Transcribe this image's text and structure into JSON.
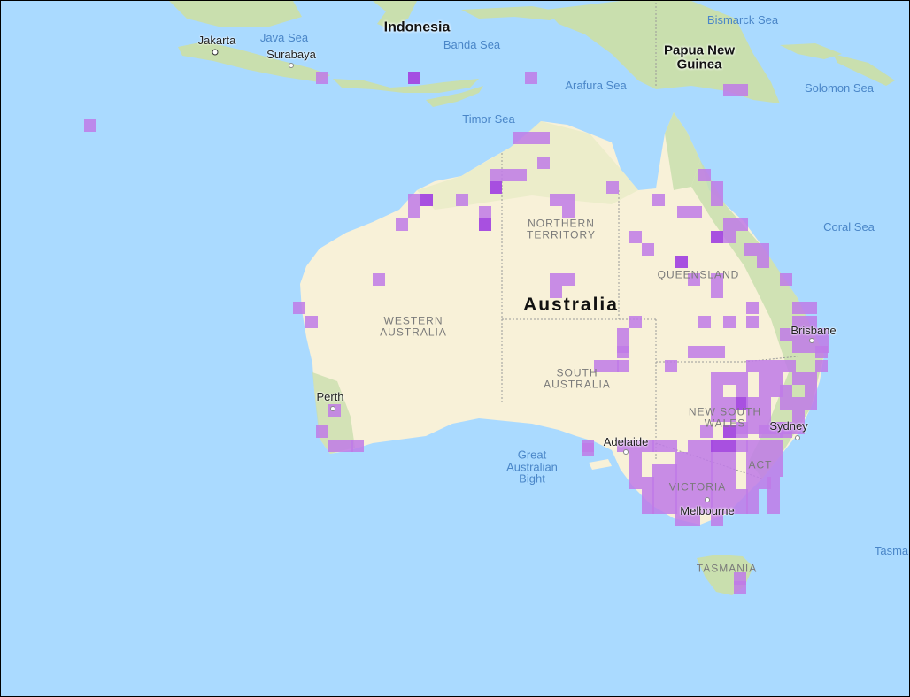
{
  "map": {
    "colors": {
      "water": "#aadaff",
      "land": "#f8f1d8",
      "vegetation": "#c9dfae",
      "cell_light": "#c07ae8",
      "cell_dark": "#a347e0"
    },
    "labels": {
      "indonesia": "Indonesia",
      "papua_new_guinea": "Papua New Guinea",
      "australia": "Australia",
      "jakarta": "Jakarta",
      "surabaya": "Surabaya",
      "java_sea": "Java Sea",
      "banda_sea": "Banda Sea",
      "bismarck_sea": "Bismarck Sea",
      "arafura_sea": "Arafura Sea",
      "solomon_sea": "Solomon Sea",
      "timor_sea": "Timor Sea",
      "coral_sea": "Coral Sea",
      "great_australian_bight": "Great Australian Bight",
      "tasman": "Tasma",
      "northern_territory": "NORTHERN TERRITORY",
      "western_australia": "WESTERN AUSTRALIA",
      "queensland": "QUEENSLAND",
      "south_australia": "SOUTH AUSTRALIA",
      "new_south_wales": "NEW SOUTH WALES",
      "victoria": "VICTORIA",
      "tasmania": "TASMANIA",
      "act": "ACT",
      "perth": "Perth",
      "adelaide": "Adelaide",
      "melbourne": "Melbourne",
      "sydney": "Sydney",
      "brisbane": "Brisbane"
    },
    "occurrence_cells": [
      [
        94,
        134,
        0
      ],
      [
        356,
        80,
        0
      ],
      [
        460,
        80,
        1
      ],
      [
        592,
        80,
        0
      ],
      [
        816,
        94,
        0
      ],
      [
        830,
        94,
        0
      ],
      [
        578,
        148,
        0
      ],
      [
        592,
        148,
        0
      ],
      [
        606,
        148,
        0
      ],
      [
        606,
        176,
        0
      ],
      [
        552,
        190,
        0
      ],
      [
        566,
        190,
        0
      ],
      [
        580,
        190,
        0
      ],
      [
        788,
        190,
        0
      ],
      [
        552,
        204,
        1
      ],
      [
        684,
        204,
        0
      ],
      [
        802,
        204,
        0
      ],
      [
        460,
        218,
        0
      ],
      [
        474,
        218,
        1
      ],
      [
        514,
        218,
        0
      ],
      [
        620,
        218,
        0
      ],
      [
        634,
        218,
        0
      ],
      [
        736,
        218,
        0
      ],
      [
        802,
        218,
        0
      ],
      [
        460,
        232,
        0
      ],
      [
        540,
        232,
        0
      ],
      [
        634,
        232,
        0
      ],
      [
        764,
        232,
        0
      ],
      [
        778,
        232,
        0
      ],
      [
        446,
        246,
        0
      ],
      [
        540,
        246,
        1
      ],
      [
        816,
        246,
        0
      ],
      [
        830,
        246,
        0
      ],
      [
        710,
        260,
        0
      ],
      [
        802,
        260,
        1
      ],
      [
        816,
        260,
        0
      ],
      [
        724,
        274,
        0
      ],
      [
        840,
        274,
        0
      ],
      [
        854,
        274,
        0
      ],
      [
        762,
        288,
        1
      ],
      [
        854,
        288,
        0
      ],
      [
        420,
        308,
        0
      ],
      [
        620,
        308,
        0
      ],
      [
        634,
        308,
        0
      ],
      [
        776,
        308,
        0
      ],
      [
        802,
        308,
        0
      ],
      [
        880,
        308,
        0
      ],
      [
        620,
        322,
        0
      ],
      [
        802,
        322,
        0
      ],
      [
        330,
        340,
        0
      ],
      [
        842,
        340,
        0
      ],
      [
        894,
        340,
        0
      ],
      [
        908,
        340,
        0
      ],
      [
        344,
        356,
        0
      ],
      [
        710,
        356,
        0
      ],
      [
        788,
        356,
        0
      ],
      [
        816,
        356,
        0
      ],
      [
        842,
        356,
        0
      ],
      [
        894,
        356,
        0
      ],
      [
        908,
        356,
        0
      ],
      [
        696,
        370,
        0
      ],
      [
        880,
        370,
        0
      ],
      [
        894,
        370,
        0
      ],
      [
        908,
        370,
        0
      ],
      [
        922,
        370,
        0
      ],
      [
        696,
        384,
        0
      ],
      [
        894,
        384,
        0
      ],
      [
        908,
        384,
        0
      ],
      [
        922,
        384,
        0
      ],
      [
        696,
        390,
        0
      ],
      [
        776,
        390,
        0
      ],
      [
        790,
        390,
        0
      ],
      [
        804,
        390,
        0
      ],
      [
        920,
        390,
        0
      ],
      [
        670,
        406,
        0
      ],
      [
        684,
        406,
        0
      ],
      [
        696,
        406,
        0
      ],
      [
        750,
        406,
        0
      ],
      [
        842,
        406,
        0
      ],
      [
        856,
        406,
        0
      ],
      [
        870,
        406,
        0
      ],
      [
        884,
        406,
        0
      ],
      [
        920,
        406,
        0
      ],
      [
        802,
        420,
        0
      ],
      [
        816,
        420,
        0
      ],
      [
        830,
        420,
        0
      ],
      [
        856,
        420,
        0
      ],
      [
        870,
        420,
        0
      ],
      [
        894,
        420,
        0
      ],
      [
        908,
        420,
        0
      ],
      [
        802,
        434,
        0
      ],
      [
        830,
        434,
        0
      ],
      [
        856,
        434,
        0
      ],
      [
        870,
        434,
        0
      ],
      [
        880,
        434,
        0
      ],
      [
        908,
        434,
        0
      ],
      [
        802,
        448,
        0
      ],
      [
        816,
        448,
        0
      ],
      [
        830,
        448,
        1
      ],
      [
        842,
        448,
        0
      ],
      [
        856,
        448,
        0
      ],
      [
        880,
        448,
        0
      ],
      [
        894,
        448,
        0
      ],
      [
        908,
        448,
        0
      ],
      [
        802,
        462,
        0
      ],
      [
        816,
        462,
        0
      ],
      [
        842,
        462,
        0
      ],
      [
        856,
        462,
        0
      ],
      [
        894,
        462,
        0
      ],
      [
        370,
        456,
        0
      ],
      [
        830,
        476,
        0
      ],
      [
        842,
        476,
        0
      ],
      [
        856,
        476,
        0
      ],
      [
        870,
        476,
        0
      ],
      [
        880,
        476,
        0
      ],
      [
        894,
        476,
        0
      ],
      [
        356,
        480,
        0
      ],
      [
        790,
        480,
        0
      ],
      [
        816,
        480,
        1
      ],
      [
        830,
        480,
        0
      ],
      [
        856,
        480,
        0
      ],
      [
        870,
        480,
        0
      ],
      [
        880,
        480,
        0
      ],
      [
        370,
        496,
        0
      ],
      [
        384,
        496,
        0
      ],
      [
        396,
        496,
        0
      ],
      [
        656,
        496,
        0
      ],
      [
        696,
        496,
        0
      ],
      [
        710,
        496,
        0
      ],
      [
        724,
        496,
        0
      ],
      [
        736,
        496,
        0
      ],
      [
        750,
        496,
        0
      ],
      [
        776,
        496,
        0
      ],
      [
        790,
        496,
        0
      ],
      [
        802,
        496,
        1
      ],
      [
        816,
        496,
        1
      ],
      [
        830,
        496,
        0
      ],
      [
        842,
        496,
        0
      ],
      [
        856,
        496,
        0
      ],
      [
        870,
        496,
        0
      ],
      [
        656,
        500,
        0
      ],
      [
        710,
        510,
        0
      ],
      [
        762,
        510,
        0
      ],
      [
        776,
        510,
        0
      ],
      [
        790,
        510,
        0
      ],
      [
        802,
        510,
        0
      ],
      [
        816,
        510,
        0
      ],
      [
        842,
        510,
        0
      ],
      [
        856,
        510,
        0
      ],
      [
        870,
        510,
        0
      ],
      [
        710,
        524,
        0
      ],
      [
        736,
        524,
        0
      ],
      [
        750,
        524,
        0
      ],
      [
        762,
        524,
        0
      ],
      [
        776,
        524,
        0
      ],
      [
        790,
        524,
        0
      ],
      [
        802,
        524,
        0
      ],
      [
        816,
        524,
        0
      ],
      [
        842,
        524,
        0
      ],
      [
        856,
        524,
        0
      ],
      [
        870,
        524,
        0
      ],
      [
        710,
        538,
        0
      ],
      [
        724,
        538,
        0
      ],
      [
        736,
        538,
        0
      ],
      [
        750,
        538,
        0
      ],
      [
        762,
        538,
        0
      ],
      [
        776,
        538,
        0
      ],
      [
        790,
        538,
        0
      ],
      [
        802,
        538,
        0
      ],
      [
        816,
        538,
        0
      ],
      [
        842,
        538,
        0
      ],
      [
        856,
        538,
        0
      ],
      [
        866,
        538,
        0
      ],
      [
        724,
        552,
        0
      ],
      [
        736,
        552,
        0
      ],
      [
        750,
        552,
        0
      ],
      [
        762,
        552,
        0
      ],
      [
        776,
        552,
        0
      ],
      [
        790,
        552,
        0
      ],
      [
        802,
        552,
        0
      ],
      [
        816,
        552,
        0
      ],
      [
        830,
        552,
        0
      ],
      [
        842,
        552,
        0
      ],
      [
        866,
        552,
        0
      ],
      [
        724,
        566,
        0
      ],
      [
        736,
        566,
        0
      ],
      [
        750,
        566,
        0
      ],
      [
        762,
        566,
        0
      ],
      [
        776,
        566,
        0
      ],
      [
        790,
        566,
        0
      ],
      [
        802,
        566,
        0
      ],
      [
        816,
        566,
        0
      ],
      [
        830,
        566,
        0
      ],
      [
        842,
        566,
        0
      ],
      [
        866,
        566,
        0
      ],
      [
        762,
        580,
        0
      ],
      [
        776,
        580,
        0
      ],
      [
        802,
        580,
        0
      ],
      [
        828,
        646,
        0
      ],
      [
        828,
        656,
        0
      ]
    ]
  }
}
